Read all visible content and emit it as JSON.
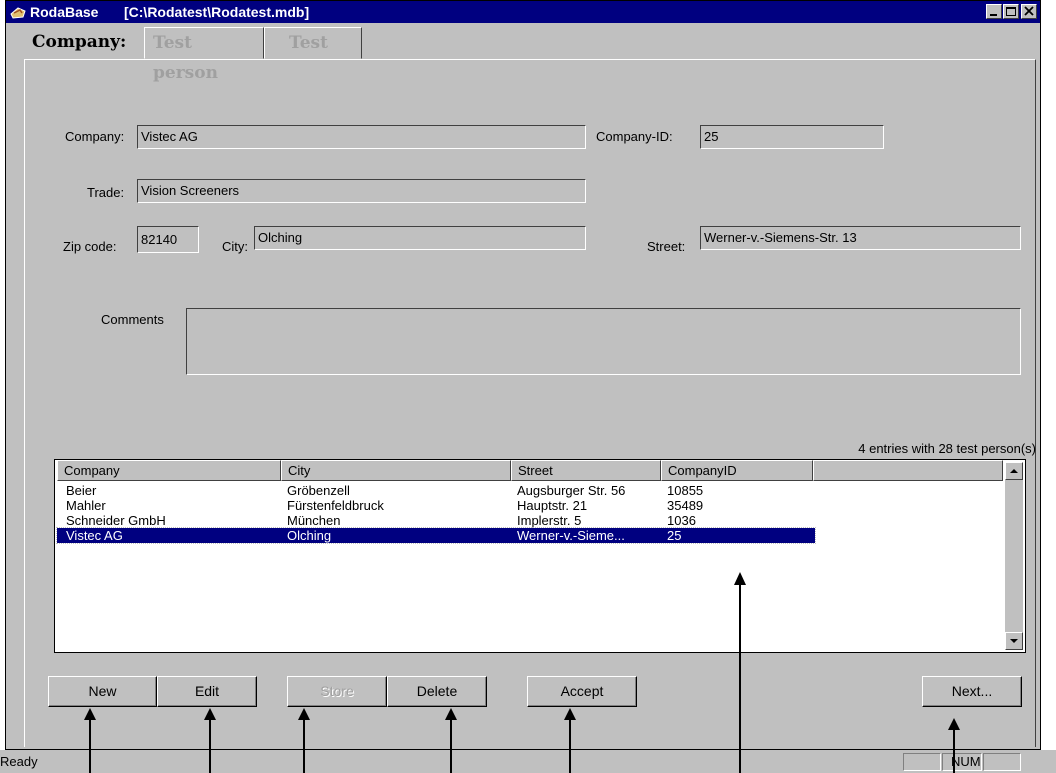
{
  "window": {
    "app_name": "RodaBase",
    "file_path": "[C:\\Rodatest\\Rodatest.mdb]"
  },
  "tabs": [
    {
      "label": "Company:",
      "active": true
    },
    {
      "label": "Test person",
      "active": false
    },
    {
      "label": "Test",
      "active": false
    }
  ],
  "form": {
    "company_label": "Company:",
    "company_value": "Vistec AG",
    "company_id_label": "Company-ID:",
    "company_id_value": "25",
    "trade_label": "Trade:",
    "trade_value": "Vision Screeners",
    "zip_label": "Zip code:",
    "zip_value": "82140",
    "city_label": "City:",
    "city_value": "Olching",
    "street_label": "Street:",
    "street_value": "Werner-v.-Siemens-Str. 13",
    "comments_label": "Comments",
    "comments_value": ""
  },
  "list": {
    "summary": "4 entries with 28 test person(s)",
    "columns": [
      "Company",
      "City",
      "Street",
      "CompanyID"
    ],
    "rows": [
      {
        "company": "Beier",
        "city": "Gröbenzell",
        "street": "Augsburger Str. 56",
        "id": "10855",
        "selected": false
      },
      {
        "company": "Mahler",
        "city": "Fürstenfeldbruck",
        "street": "Hauptstr. 21",
        "id": "35489",
        "selected": false
      },
      {
        "company": "Schneider GmbH",
        "city": "München",
        "street": "Implerstr. 5",
        "id": "1036",
        "selected": false
      },
      {
        "company": "Vistec AG",
        "city": "Olching",
        "street": "Werner-v.-Sieme...",
        "id": "25",
        "selected": true
      }
    ]
  },
  "buttons": {
    "new": "New",
    "edit": "Edit",
    "store": "Store",
    "delete": "Delete",
    "accept": "Accept",
    "next": "Next..."
  },
  "status": {
    "text": "Ready",
    "num": "NUM"
  },
  "colors": {
    "titlebar": "#000080",
    "face": "#c0c0c0",
    "selection": "#000080"
  }
}
